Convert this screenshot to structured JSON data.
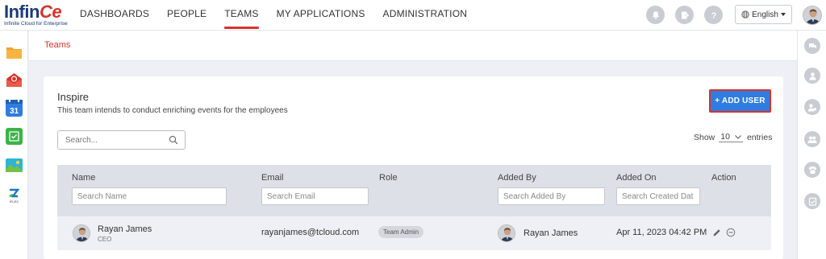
{
  "brand": {
    "name_main": "Infin",
    "name_accent": "Ce",
    "tagline": "Infinite Cloud for Enterprise"
  },
  "nav": [
    {
      "label": "DASHBOARDS",
      "active": false
    },
    {
      "label": "PEOPLE",
      "active": false
    },
    {
      "label": "TEAMS",
      "active": true
    },
    {
      "label": "MY APPLICATIONS",
      "active": false
    },
    {
      "label": "ADMINISTRATION",
      "active": false
    }
  ],
  "header": {
    "language": "English",
    "icons": [
      "bell-icon",
      "export-icon",
      "help-icon"
    ]
  },
  "left_apps": [
    "files-app-icon",
    "mail-app-icon",
    "calendar-app-icon",
    "sheets-app-icon",
    "gallery-app-icon",
    "iflex-app-icon"
  ],
  "calendar_day": "31",
  "right_icons": [
    "chat-icon",
    "person-icon",
    "user-settings-icon",
    "group-icon",
    "phone-icon",
    "tasks-icon"
  ],
  "breadcrumb": "Teams",
  "team": {
    "name": "Inspire",
    "description": "This team intends to conduct enriching events for the employees",
    "add_user_label": "+ ADD USER"
  },
  "search": {
    "placeholder": "Search..."
  },
  "entries": {
    "show_label": "Show",
    "value": "10",
    "suffix": "entries"
  },
  "table": {
    "columns": [
      {
        "label": "Name",
        "filter_placeholder": "Search Name"
      },
      {
        "label": "Email",
        "filter_placeholder": "Search Email"
      },
      {
        "label": "Role",
        "filter_placeholder": ""
      },
      {
        "label": "Added By",
        "filter_placeholder": "Search Added By"
      },
      {
        "label": "Added On",
        "filter_placeholder": "Search Created Dat"
      },
      {
        "label": "Action",
        "filter_placeholder": ""
      }
    ],
    "rows": [
      {
        "name": "Rayan James",
        "title": "CEO",
        "email": "rayanjames@tcloud.com",
        "role": "Team Admin",
        "added_by": "Rayan James",
        "added_on": "Apr 11, 2023 04:42 PM"
      }
    ]
  },
  "colors": {
    "accent": "#d8332b",
    "primary": "#2f7de1",
    "brand": "#1d3b7a"
  }
}
